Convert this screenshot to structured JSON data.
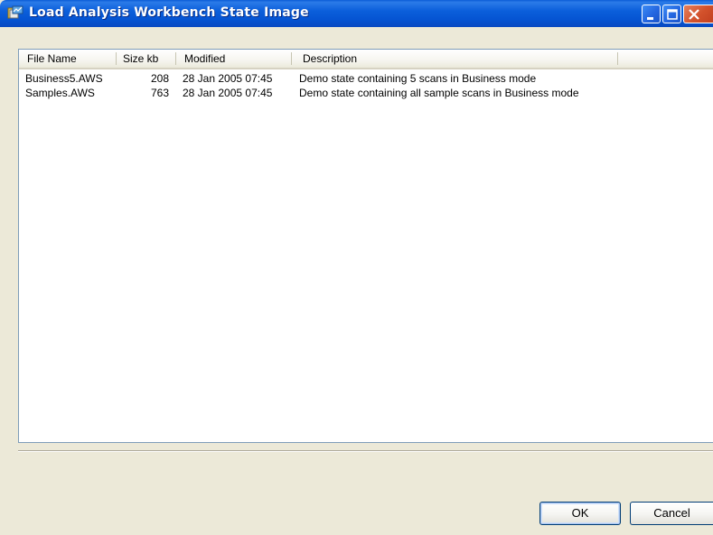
{
  "window": {
    "title": "Load Analysis Workbench State Image",
    "app_icon": "workbench-icon",
    "controls": [
      "minimize-icon",
      "maximize-icon",
      "close-icon"
    ]
  },
  "list": {
    "columns": [
      "File Name",
      "Size kb",
      "Modified",
      "Description"
    ],
    "rows": [
      {
        "file_name": "Business5.AWS",
        "size_kb": "208",
        "modified": "28 Jan 2005 07:45",
        "description": "Demo state containing 5 scans in Business mode"
      },
      {
        "file_name": "Samples.AWS",
        "size_kb": "763",
        "modified": "28 Jan 2005 07:45",
        "description": "Demo state containing all sample scans in Business mode"
      }
    ]
  },
  "buttons": {
    "ok_label": "OK",
    "cancel_label": "Cancel"
  },
  "colors": {
    "titlebar": "#0553d1",
    "close_button": "#d2512b",
    "dialog_bg": "#ece9d8"
  }
}
